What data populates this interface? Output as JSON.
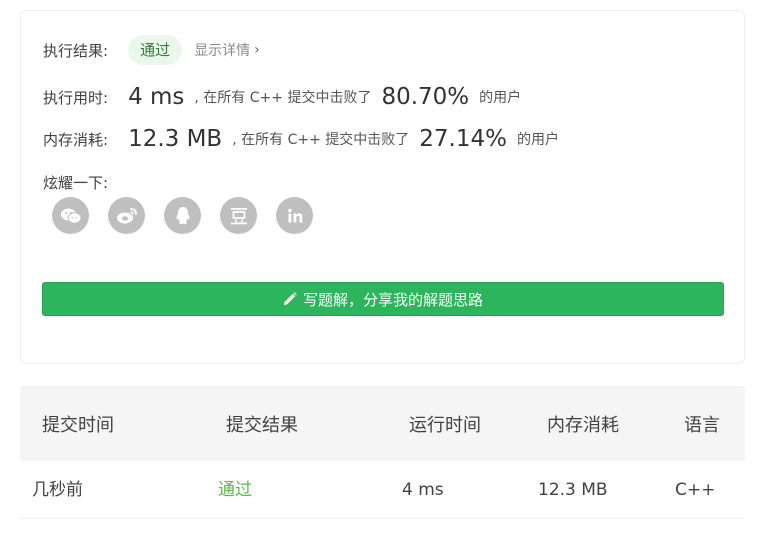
{
  "result": {
    "label": "执行结果:",
    "status": "通过",
    "details_link": "显示详情",
    "runtime": {
      "label": "执行用时:",
      "value": "4 ms",
      "beat_text": ", 在所有 C++ 提交中击败了",
      "percent": "80.70%",
      "users": "的用户"
    },
    "memory": {
      "label": "内存消耗:",
      "value": "12.3 MB",
      "beat_text": ", 在所有 C++ 提交中击败了",
      "percent": "27.14%",
      "users": "的用户"
    },
    "share_label": "炫耀一下:",
    "share_icons": [
      "wechat-icon",
      "weibo-icon",
      "qq-icon",
      "douban-icon",
      "linkedin-icon"
    ],
    "write_button": "写题解，分享我的解题思路"
  },
  "submissions": {
    "headers": [
      "提交时间",
      "提交结果",
      "运行时间",
      "内存消耗",
      "语言"
    ],
    "rows": [
      [
        "几秒前",
        "通过",
        "4 ms",
        "12.3 MB",
        "C++"
      ]
    ]
  },
  "colors": {
    "accent_green": "#2db55d",
    "pass_text": "#5fb84b",
    "pill_bg": "#ebf7ea"
  }
}
